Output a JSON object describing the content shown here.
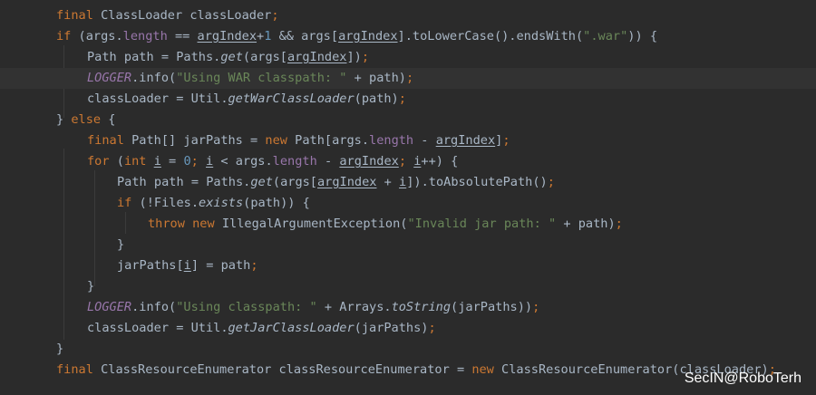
{
  "code_lines": [
    [
      {
        "t": "final",
        "c": "kw"
      },
      {
        "t": " ClassLoader classLoader",
        "c": "plain"
      },
      {
        "t": ";",
        "c": "kw"
      }
    ],
    [
      {
        "t": "if",
        "c": "kw"
      },
      {
        "t": " (args.",
        "c": "plain"
      },
      {
        "t": "length",
        "c": "field"
      },
      {
        "t": " == ",
        "c": "plain"
      },
      {
        "t": "argIndex",
        "c": "ul"
      },
      {
        "t": "+",
        "c": "plain"
      },
      {
        "t": "1",
        "c": "num"
      },
      {
        "t": " && args[",
        "c": "plain"
      },
      {
        "t": "argIndex",
        "c": "ul"
      },
      {
        "t": "].toLowerCase().endsWith(",
        "c": "plain"
      },
      {
        "t": "\".war\"",
        "c": "str"
      },
      {
        "t": ")) {",
        "c": "plain"
      }
    ],
    [
      {
        "t": "Path path = Paths.",
        "c": "plain"
      },
      {
        "t": "get",
        "c": "static"
      },
      {
        "t": "(args[",
        "c": "plain"
      },
      {
        "t": "argIndex",
        "c": "ul"
      },
      {
        "t": "])",
        "c": "plain"
      },
      {
        "t": ";",
        "c": "kw"
      }
    ],
    [
      {
        "t": "LOGGER",
        "c": "const"
      },
      {
        "t": ".info(",
        "c": "plain"
      },
      {
        "t": "\"Using WAR classpath: \"",
        "c": "str"
      },
      {
        "t": " + path)",
        "c": "plain"
      },
      {
        "t": ";",
        "c": "kw"
      }
    ],
    [
      {
        "t": "classLoader = Util.",
        "c": "plain"
      },
      {
        "t": "getWarClassLoader",
        "c": "static"
      },
      {
        "t": "(path)",
        "c": "plain"
      },
      {
        "t": ";",
        "c": "kw"
      }
    ],
    [
      {
        "t": "} ",
        "c": "plain"
      },
      {
        "t": "else",
        "c": "kw"
      },
      {
        "t": " {",
        "c": "plain"
      }
    ],
    [
      {
        "t": "final",
        "c": "kw"
      },
      {
        "t": " Path[] jarPaths = ",
        "c": "plain"
      },
      {
        "t": "new",
        "c": "kw"
      },
      {
        "t": " Path[args.",
        "c": "plain"
      },
      {
        "t": "length",
        "c": "field"
      },
      {
        "t": " - ",
        "c": "plain"
      },
      {
        "t": "argIndex",
        "c": "ul"
      },
      {
        "t": "]",
        "c": "plain"
      },
      {
        "t": ";",
        "c": "kw"
      }
    ],
    [
      {
        "t": "for",
        "c": "kw"
      },
      {
        "t": " (",
        "c": "plain"
      },
      {
        "t": "int",
        "c": "kw"
      },
      {
        "t": " ",
        "c": "plain"
      },
      {
        "t": "i",
        "c": "ul"
      },
      {
        "t": " = ",
        "c": "plain"
      },
      {
        "t": "0",
        "c": "num"
      },
      {
        "t": "; ",
        "c": "kw"
      },
      {
        "t": "i",
        "c": "ul"
      },
      {
        "t": " < args.",
        "c": "plain"
      },
      {
        "t": "length",
        "c": "field"
      },
      {
        "t": " - ",
        "c": "plain"
      },
      {
        "t": "argIndex",
        "c": "ul"
      },
      {
        "t": "; ",
        "c": "kw"
      },
      {
        "t": "i",
        "c": "ul"
      },
      {
        "t": "++) {",
        "c": "plain"
      }
    ],
    [
      {
        "t": "Path path = Paths.",
        "c": "plain"
      },
      {
        "t": "get",
        "c": "static"
      },
      {
        "t": "(args[",
        "c": "plain"
      },
      {
        "t": "argIndex",
        "c": "ul"
      },
      {
        "t": " + ",
        "c": "plain"
      },
      {
        "t": "i",
        "c": "ul"
      },
      {
        "t": "]).toAbsolutePath()",
        "c": "plain"
      },
      {
        "t": ";",
        "c": "kw"
      }
    ],
    [
      {
        "t": "if",
        "c": "kw"
      },
      {
        "t": " (!Files.",
        "c": "plain"
      },
      {
        "t": "exists",
        "c": "static"
      },
      {
        "t": "(path)) {",
        "c": "plain"
      }
    ],
    [
      {
        "t": "throw new",
        "c": "kw"
      },
      {
        "t": " IllegalArgumentException(",
        "c": "plain"
      },
      {
        "t": "\"Invalid jar path: \"",
        "c": "str"
      },
      {
        "t": " + path)",
        "c": "plain"
      },
      {
        "t": ";",
        "c": "kw"
      }
    ],
    [
      {
        "t": "}",
        "c": "plain"
      }
    ],
    [
      {
        "t": "jarPaths[",
        "c": "plain"
      },
      {
        "t": "i",
        "c": "ul"
      },
      {
        "t": "] = path",
        "c": "plain"
      },
      {
        "t": ";",
        "c": "kw"
      }
    ],
    [
      {
        "t": "}",
        "c": "plain"
      }
    ],
    [
      {
        "t": "LOGGER",
        "c": "const"
      },
      {
        "t": ".info(",
        "c": "plain"
      },
      {
        "t": "\"Using classpath: \"",
        "c": "str"
      },
      {
        "t": " + Arrays.",
        "c": "plain"
      },
      {
        "t": "toString",
        "c": "static"
      },
      {
        "t": "(jarPaths))",
        "c": "plain"
      },
      {
        "t": ";",
        "c": "kw"
      }
    ],
    [
      {
        "t": "classLoader = Util.",
        "c": "plain"
      },
      {
        "t": "getJarClassLoader",
        "c": "static"
      },
      {
        "t": "(jarPaths)",
        "c": "plain"
      },
      {
        "t": ";",
        "c": "kw"
      }
    ],
    [
      {
        "t": "}",
        "c": "plain"
      }
    ],
    [
      {
        "t": "final",
        "c": "kw"
      },
      {
        "t": " ClassResourceEnumerator classResourceEnumerator = ",
        "c": "plain"
      },
      {
        "t": "new",
        "c": "kw"
      },
      {
        "t": " ClassResourceEnumerator(classLoader)",
        "c": "plain"
      },
      {
        "t": ";",
        "c": "kw"
      }
    ]
  ],
  "watermark": "SecIN@RoboTerh",
  "colors": {
    "background": "#2b2b2b",
    "current_line": "#323232",
    "keyword": "#cc7832",
    "number": "#6897bb",
    "string": "#6a8759",
    "field": "#9876aa",
    "text": "#a9b7c6"
  }
}
